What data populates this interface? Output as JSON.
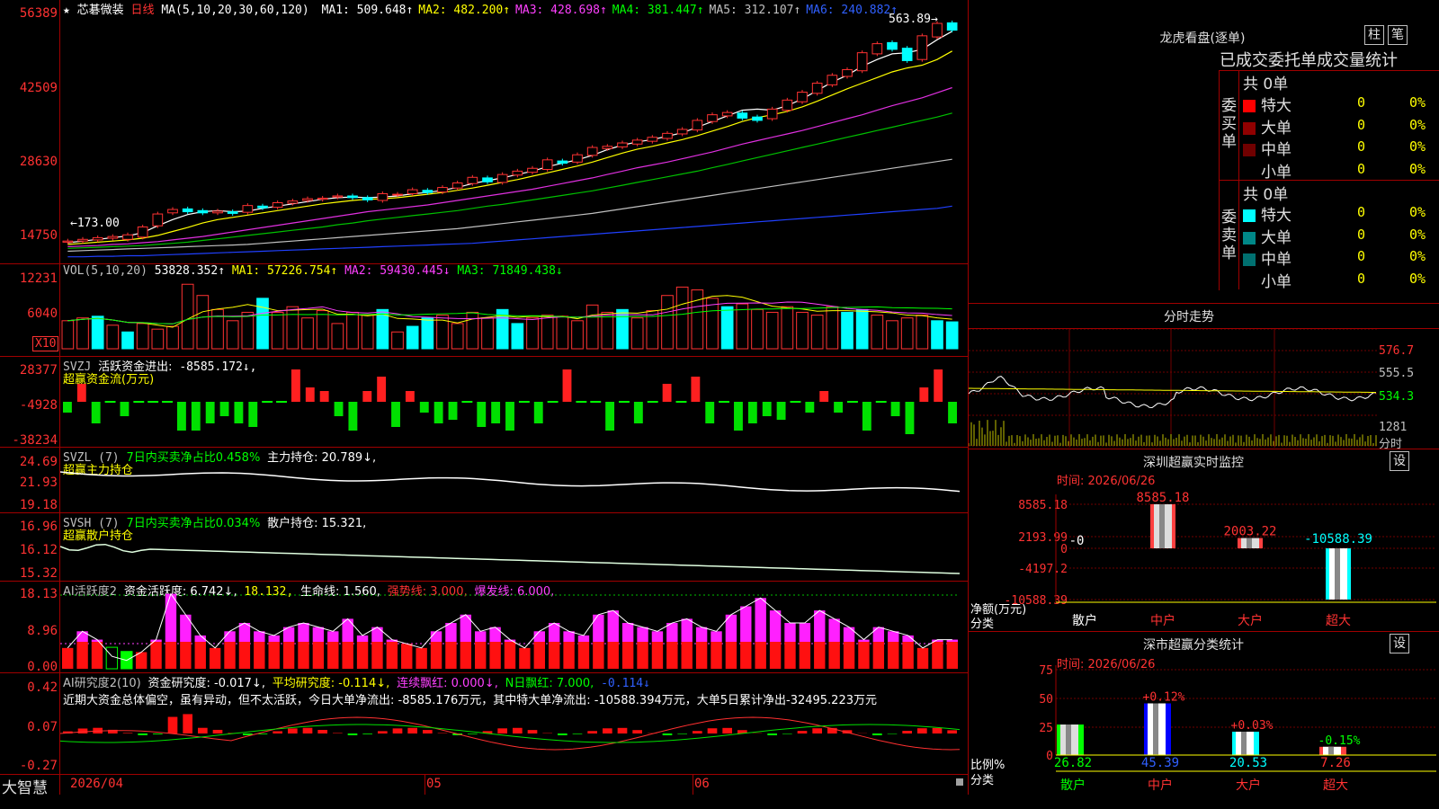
{
  "main": {
    "title_star": "★",
    "stock_name": "芯碁微装",
    "period": "日线",
    "ma_label": "MA(5,10,20,30,60,120)",
    "ma": [
      {
        "name": "MA1:",
        "value": "509.648↑",
        "color": "#ffffff"
      },
      {
        "name": "MA2:",
        "value": "482.200↑",
        "color": "#ffff00"
      },
      {
        "name": "MA3:",
        "value": "428.698↑",
        "color": "#ff40ff"
      },
      {
        "name": "MA4:",
        "value": "381.447↑",
        "color": "#00ff00"
      },
      {
        "name": "MA5:",
        "value": "312.107↑",
        "color": "#c0c0c0"
      },
      {
        "name": "MA6:",
        "value": "240.882↑",
        "color": "#3060ff"
      }
    ],
    "y_ticks": [
      "56389",
      "42509",
      "28630",
      "14750"
    ],
    "high_label": "563.89→",
    "low_label": "←173.00",
    "candles_open": [
      176,
      178,
      180,
      183,
      181,
      185,
      205,
      228,
      235,
      232,
      228,
      230,
      229,
      240,
      238,
      245,
      250,
      252,
      256,
      258,
      255,
      250,
      260,
      262,
      268,
      265,
      272,
      280,
      290,
      282,
      295,
      300,
      305,
      320,
      318,
      330,
      342,
      345,
      350,
      355,
      360,
      368,
      375,
      390,
      400,
      405,
      398,
      395,
      410,
      425,
      440,
      455,
      470,
      480,
      510,
      530,
      520,
      500,
      540,
      565
    ],
    "candles_close": [
      178,
      181,
      184,
      186,
      189,
      203,
      226,
      234,
      230,
      228,
      231,
      227,
      241,
      237,
      246,
      249,
      253,
      254,
      258,
      255,
      251,
      262,
      261,
      269,
      264,
      273,
      281,
      291,
      283,
      296,
      302,
      307,
      322,
      316,
      331,
      344,
      346,
      352,
      357,
      362,
      369,
      376,
      392,
      402,
      406,
      396,
      392,
      412,
      428,
      442,
      458,
      472,
      482,
      512,
      528,
      518,
      498,
      542,
      564,
      552
    ],
    "ma_lines": {
      "ma5": [
        175,
        178,
        181,
        184,
        187,
        193,
        205,
        216,
        225,
        230,
        232,
        230,
        231,
        236,
        240,
        244,
        248,
        252,
        255,
        256,
        255,
        256,
        258,
        262,
        264,
        268,
        273,
        280,
        285,
        290,
        296,
        302,
        310,
        316,
        322,
        330,
        340,
        348,
        354,
        358,
        364,
        370,
        380,
        390,
        400,
        410,
        412,
        410,
        418,
        430,
        445,
        460,
        472,
        488,
        500,
        510,
        512,
        518,
        535,
        550
      ],
      "ma10": [
        172,
        174,
        176,
        178,
        180,
        183,
        188,
        195,
        202,
        210,
        216,
        220,
        224,
        228,
        232,
        236,
        240,
        244,
        247,
        250,
        252,
        253,
        255,
        258,
        261,
        264,
        268,
        272,
        277,
        282,
        287,
        293,
        299,
        305,
        311,
        318,
        326,
        334,
        341,
        346,
        352,
        358,
        365,
        373,
        381,
        390,
        397,
        402,
        408,
        416,
        426,
        437,
        448,
        458,
        468,
        478,
        485,
        490,
        500,
        515
      ],
      "ma20": [
        168,
        169,
        170,
        172,
        173,
        175,
        177,
        180,
        183,
        186,
        190,
        194,
        198,
        202,
        206,
        210,
        214,
        218,
        222,
        226,
        230,
        233,
        236,
        239,
        242,
        246,
        250,
        254,
        258,
        262,
        266,
        270,
        275,
        280,
        285,
        290,
        296,
        302,
        308,
        313,
        318,
        324,
        330,
        336,
        343,
        350,
        356,
        362,
        368,
        374,
        381,
        388,
        395,
        402,
        410,
        418,
        425,
        432,
        441,
        450
      ],
      "ma30": [
        165,
        166,
        167,
        168,
        169,
        170,
        172,
        174,
        176,
        179,
        182,
        185,
        188,
        191,
        194,
        197,
        200,
        203,
        207,
        210,
        214,
        217,
        220,
        223,
        226,
        229,
        232,
        236,
        240,
        243,
        247,
        251,
        255,
        259,
        263,
        267,
        272,
        277,
        282,
        287,
        292,
        297,
        302,
        308,
        314,
        320,
        326,
        332,
        338,
        344,
        350,
        356,
        362,
        368,
        374,
        380,
        386,
        392,
        398,
        405
      ],
      "ma60": [
        160,
        161,
        162,
        163,
        164,
        165,
        166,
        167,
        168,
        169,
        170,
        171,
        172,
        174,
        176,
        178,
        180,
        182,
        184,
        186,
        188,
        190,
        192,
        194,
        196,
        198,
        200,
        203,
        206,
        209,
        212,
        215,
        218,
        221,
        224,
        227,
        231,
        235,
        239,
        243,
        247,
        251,
        255,
        259,
        263,
        267,
        271,
        275,
        279,
        283,
        287,
        291,
        295,
        299,
        303,
        307,
        311,
        315,
        319,
        323
      ],
      "ma120": [
        150,
        150,
        151,
        151,
        152,
        152,
        153,
        154,
        155,
        156,
        157,
        158,
        159,
        160,
        161,
        162,
        163,
        164,
        165,
        166,
        167,
        168,
        169,
        170,
        171,
        172,
        173,
        174,
        176,
        178,
        180,
        182,
        184,
        186,
        188,
        190,
        192,
        194,
        196,
        198,
        200,
        202,
        204,
        206,
        208,
        210,
        212,
        214,
        216,
        218,
        220,
        222,
        224,
        226,
        228,
        230,
        232,
        234,
        236,
        240
      ]
    }
  },
  "volume": {
    "title": "VOL(5,10,20)",
    "value": "53828.352↑",
    "ma1": "MA1: 57226.754↑",
    "ma2": "MA2: 59430.445↓",
    "ma3": "MA3: 71849.438↓",
    "y_ticks": [
      "12231",
      "6040"
    ],
    "unit": "X10",
    "bars": [
      5000,
      5500,
      5800,
      4200,
      3000,
      4500,
      3500,
      4000,
      11500,
      9500,
      7000,
      5000,
      6500,
      9000,
      6500,
      7500,
      5500,
      6800,
      4500,
      6500,
      6000,
      7000,
      3000,
      4000,
      5500,
      6000,
      4500,
      6500,
      5500,
      7000,
      4500,
      5500,
      6000,
      5800,
      5000,
      7800,
      6500,
      7000,
      5500,
      6800,
      9500,
      11000,
      10500,
      9000,
      7500,
      8000,
      7000,
      6500,
      7500,
      6500,
      6000,
      7500,
      6500,
      7000,
      6000,
      5000,
      5500,
      6000,
      5000,
      4800
    ],
    "cyan_mask": [
      0,
      0,
      1,
      0,
      1,
      0,
      0,
      0,
      0,
      0,
      0,
      0,
      0,
      1,
      0,
      0,
      0,
      0,
      0,
      0,
      0,
      1,
      0,
      1,
      1,
      0,
      0,
      0,
      0,
      1,
      1,
      0,
      0,
      0,
      0,
      0,
      0,
      1,
      0,
      0,
      0,
      0,
      0,
      0,
      1,
      0,
      0,
      0,
      0,
      0,
      0,
      0,
      1,
      1,
      0,
      0,
      0,
      0,
      1,
      1
    ]
  },
  "svzj": {
    "title": "SVZJ",
    "name": "活跃资金进出:",
    "value": "-8585.172↓,",
    "sub": "超赢资金流(万元)",
    "y_ticks": [
      "28377",
      "-4928",
      "-38234"
    ],
    "bars": [
      -3000,
      5000,
      -6000,
      0,
      -4000,
      0,
      0,
      0,
      -8000,
      -8000,
      -6000,
      -4000,
      -6000,
      -7000,
      0,
      0,
      9000,
      4000,
      3000,
      -4000,
      -8000,
      3000,
      7000,
      -7000,
      3000,
      -3000,
      -6000,
      -5000,
      0,
      -7000,
      -6000,
      -8000,
      0,
      -6000,
      0,
      9000,
      0,
      0,
      -8000,
      0,
      -6000,
      0,
      5000,
      0,
      7000,
      -6000,
      0,
      -8000,
      -6000,
      -4000,
      -5000,
      0,
      -3000,
      3000,
      -3000,
      0,
      -8000,
      0,
      -4000,
      -9000,
      4000,
      9000,
      -6000
    ]
  },
  "svzl": {
    "title": "SVZL (7)",
    "desc": "7日内买卖净占比0.458%",
    "hold": "主力持仓: 20.789↓,",
    "sub": "超赢主力持仓",
    "y_ticks": [
      "24.69",
      "21.93",
      "19.18"
    ]
  },
  "svsh": {
    "title": "SVSH (7)",
    "desc": "7日内买卖净占比0.034%",
    "hold": "散户持仓: 15.321,",
    "sub": "超赢散户持仓",
    "y_ticks": [
      "16.96",
      "16.12",
      "15.32"
    ]
  },
  "ai_active": {
    "title": "AI活跃度2",
    "a": "资金活跃度: 6.742↓,",
    "b": "18.132,",
    "c": "生命线: 1.560,",
    "d": "强势线: 3.000,",
    "e": "爆发线: 6.000,",
    "y_ticks": [
      "18.13",
      "8.96",
      "0.00"
    ],
    "bars": [
      5,
      9,
      7,
      3,
      2,
      4,
      7,
      18,
      13,
      8,
      5,
      9,
      11,
      9,
      8,
      10,
      11,
      10,
      9,
      12,
      8,
      10,
      7,
      6,
      5,
      9,
      11,
      13,
      9,
      10,
      7,
      5,
      9,
      11,
      9,
      8,
      13,
      14,
      11,
      10,
      9,
      11,
      12,
      10,
      9,
      13,
      15,
      17,
      14,
      11,
      11,
      14,
      12,
      10,
      7,
      10,
      9,
      8,
      5,
      7,
      7
    ]
  },
  "ai_research": {
    "title": "AI研究度2(10)",
    "a": "资金研究度: -0.017↓,",
    "b": "平均研究度: -0.114↓,",
    "c": "连续飘红: 0.000↓,",
    "d": "N日飘红: 7.000,",
    "e": "-0.114↓",
    "text": "近期大资金总体偏空，虽有异动，但不太活跃，今日大单净流出: -8585.176万元，其中特大单净流出: -10588.394万元，大单5日累计净出-32495.223万元",
    "y_ticks": [
      "0.42",
      "0.07",
      "-0.27"
    ]
  },
  "x_axis": {
    "labels": [
      "2026/04",
      "05",
      "06"
    ],
    "app_name": "大智慧"
  },
  "right": {
    "lhb_title": "龙虎看盘(逐单)",
    "btn_bar": "柱",
    "btn_pen": "笔",
    "table_title": "已成交委托单成交量统计",
    "buy_label": "委买单",
    "sell_label": "委卖单",
    "buy_total": "共 0单",
    "sell_total": "共 0单",
    "buy_rows": [
      {
        "name": "特大",
        "count": "0",
        "pct": "0%",
        "color": "#ff0000"
      },
      {
        "name": "大单",
        "count": "0",
        "pct": "0%",
        "color": "#900000"
      },
      {
        "name": "中单",
        "count": "0",
        "pct": "0%",
        "color": "#700000"
      },
      {
        "name": "小单",
        "count": "0",
        "pct": "0%",
        "color": ""
      }
    ],
    "sell_rows": [
      {
        "name": "特大",
        "count": "0",
        "pct": "0%",
        "color": "#00ffff"
      },
      {
        "name": "大单",
        "count": "0",
        "pct": "0%",
        "color": "#008888"
      },
      {
        "name": "中单",
        "count": "0",
        "pct": "0%",
        "color": "#007070"
      },
      {
        "name": "小单",
        "count": "0",
        "pct": "0%",
        "color": ""
      }
    ],
    "minute_title": "分时走势",
    "minute_ticks": [
      "576.7",
      "555.5",
      "534.3"
    ],
    "minute_vol": "1281",
    "minute_vol_unit": "分时",
    "sz_title": "深圳超赢实时监控",
    "sz_set": "设",
    "sz_time": "时间: 2026/06/26",
    "sz_y": [
      "8585.18",
      "2193.99",
      "0",
      "-4197.2",
      "-10588.39"
    ],
    "sz_axis_a": "净额(万元)",
    "sz_axis_b": "分类",
    "sz_cats": [
      "散户",
      "中户",
      "大户",
      "超大"
    ],
    "sz_vals": [
      "-0",
      "8585.18",
      "2003.22",
      "-10588.39"
    ],
    "stat_title": "深市超赢分类统计",
    "stat_set": "设",
    "stat_time": "时间: 2026/06/26",
    "stat_y": [
      "75",
      "50",
      "25",
      "0"
    ],
    "stat_axis_a": "比例%",
    "stat_axis_b": "分类",
    "stat_cats": [
      "散户",
      "中户",
      "大户",
      "超大"
    ],
    "stat_vals": [
      "26.82",
      "45.39",
      "20.53",
      "7.26"
    ],
    "stat_delta": [
      "",
      "+0.12%",
      "+0.03%",
      "-0.15%"
    ]
  }
}
